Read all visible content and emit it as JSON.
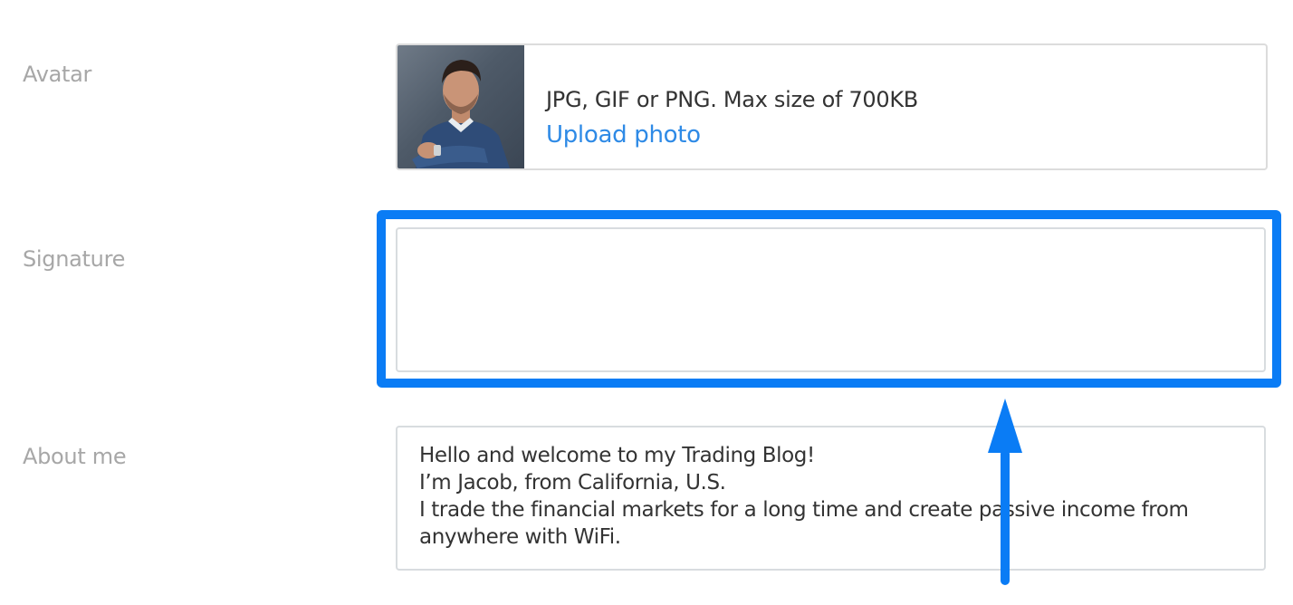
{
  "avatar": {
    "label": "Avatar",
    "hint": "JPG, GIF or PNG. Max size of 700KB",
    "upload_label": "Upload photo"
  },
  "signature": {
    "label": "Signature",
    "value": ""
  },
  "about": {
    "label": "About me",
    "lines": [
      "Hello and welcome to my Trading Blog!",
      "I’m Jacob, from California, U.S.",
      "I trade the financial markets for a long time and create passive income from",
      "anywhere with WiFi."
    ]
  },
  "colors": {
    "highlight": "#0a7cf5",
    "link": "#2e8ae6",
    "label": "#a7a7a7"
  },
  "icons": {
    "annotation": "arrow-up-icon"
  }
}
